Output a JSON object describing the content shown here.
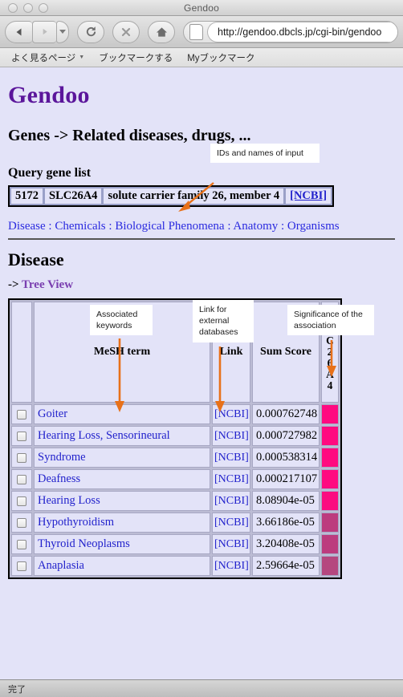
{
  "window": {
    "title": "Gendoo"
  },
  "browser": {
    "back_icon": "back-arrow-icon",
    "forward_icon": "forward-arrow-icon",
    "dropdown_icon": "chevron-down-icon",
    "reload_label": "↻",
    "stop_label": "✕",
    "home_label": "⌂",
    "url": "http://gendoo.dbcls.jp/cgi-bin/gendoo",
    "bookmarks": [
      {
        "label": "よく見るページ",
        "has_caret": true
      },
      {
        "label": "ブックマークする",
        "has_caret": false
      },
      {
        "label": "Myブックマーク",
        "has_caret": false
      }
    ]
  },
  "page": {
    "brand": "Gendoo",
    "heading": "Genes -> Related diseases, drugs, ...",
    "query_section_title": "Query gene list",
    "query_gene": {
      "id": "5172",
      "symbol": "SLC26A4",
      "description": "solute carrier family 26, member 4",
      "link_label": "[NCBI]"
    },
    "nav_links": [
      "Disease",
      "Chemicals",
      "Biological Phenomena",
      "Anatomy",
      "Organisms"
    ],
    "nav_separator": " : ",
    "section_title": "Disease",
    "tree_view_prefix": "-> ",
    "tree_view_label": "Tree View"
  },
  "table": {
    "headers": {
      "checkbox": "",
      "mesh": "MeSH term",
      "link": "Link",
      "score": "Sum Score",
      "gene": "SLC26A4"
    },
    "rows": [
      {
        "mesh": "Goiter",
        "link": "[NCBI]",
        "score": "0.000762748",
        "color": "#ff0a80"
      },
      {
        "mesh": "Hearing Loss, Sensorineural",
        "link": "[NCBI]",
        "score": "0.000727982",
        "color": "#ff0a80"
      },
      {
        "mesh": "Syndrome",
        "link": "[NCBI]",
        "score": "0.000538314",
        "color": "#ff0a80"
      },
      {
        "mesh": "Deafness",
        "link": "[NCBI]",
        "score": "0.000217107",
        "color": "#ff0a80"
      },
      {
        "mesh": "Hearing Loss",
        "link": "[NCBI]",
        "score": "8.08904e-05",
        "color": "#fb0c80"
      },
      {
        "mesh": "Hypothyroidism",
        "link": "[NCBI]",
        "score": "3.66186e-05",
        "color": "#bc3b7e"
      },
      {
        "mesh": "Thyroid Neoplasms",
        "link": "[NCBI]",
        "score": "3.20408e-05",
        "color": "#bc3b7e"
      },
      {
        "mesh": "Anaplasia",
        "link": "[NCBI]",
        "score": "2.59664e-05",
        "color": "#b5477f"
      }
    ]
  },
  "annotations": [
    {
      "text": "IDs and names of input"
    },
    {
      "text": "Associated keywords"
    },
    {
      "text": "Link for external databases"
    },
    {
      "text": "Significance of the association"
    }
  ],
  "status": {
    "text": "完了"
  },
  "colors": {
    "brand": "#5b169b",
    "link": "#2222cc",
    "nav_link": "#2a2adf",
    "tree_link": "#7a3fb0",
    "page_bg": "#e3e3f8",
    "annotation_accent": "#e8711a"
  }
}
